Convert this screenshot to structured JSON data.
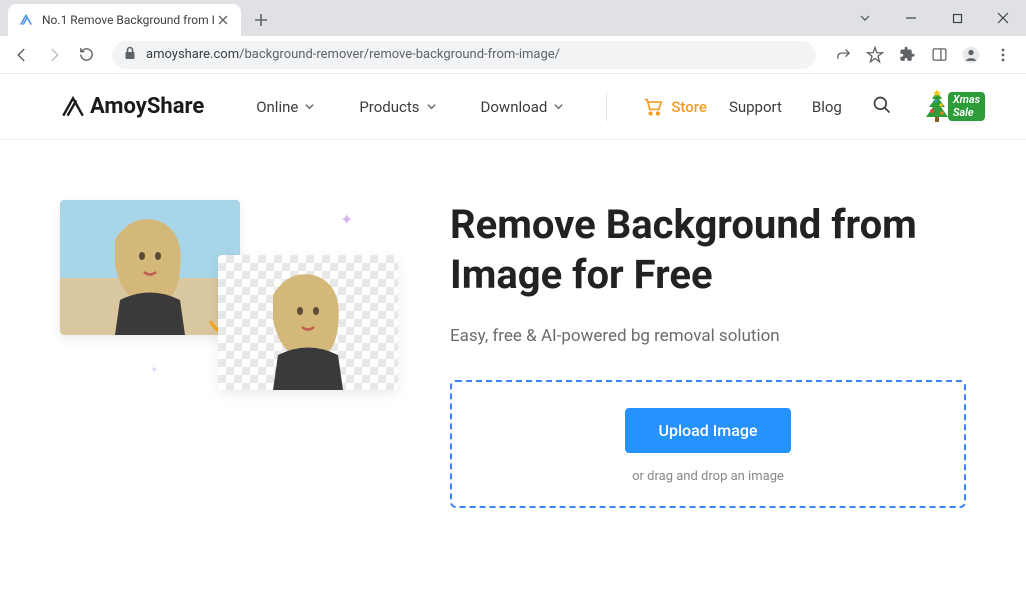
{
  "browser": {
    "tab_title": "No.1 Remove Background from I",
    "url_host": "amoyshare.com",
    "url_path": "/background-remover/remove-background-from-image/"
  },
  "header": {
    "brand": "AmoyShare",
    "nav": {
      "online": "Online",
      "products": "Products",
      "download": "Download",
      "store": "Store",
      "support": "Support",
      "blog": "Blog"
    },
    "xmas": {
      "line1": "Xmas",
      "line2": "Sale"
    }
  },
  "hero": {
    "headline": "Remove Background from Image for Free",
    "subhead": "Easy, free & AI-powered bg removal solution",
    "upload_label": "Upload Image",
    "drop_hint": "or drag and drop an image"
  }
}
